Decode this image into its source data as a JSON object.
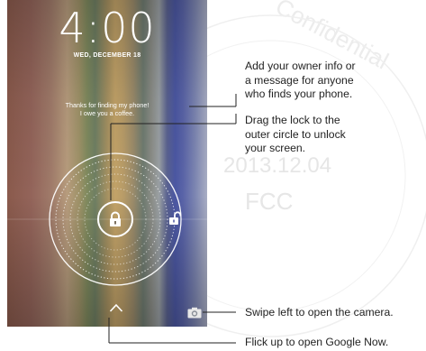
{
  "lockscreen": {
    "time": "4:00",
    "date": "WED, DECEMBER 18",
    "owner_message_line1": "Thanks for finding my phone!",
    "owner_message_line2": "I owe you a coffee."
  },
  "icons": {
    "lock": "lock-icon",
    "unlock": "unlock-icon",
    "camera": "camera-icon",
    "chevron_up": "chevron-up-icon"
  },
  "callouts": [
    {
      "lines": [
        "Add your owner info or",
        "a message for anyone",
        "who finds your phone."
      ]
    },
    {
      "lines": [
        "Drag the lock to the",
        "outer circle to unlock",
        "your screen."
      ]
    },
    {
      "lines": [
        "Swipe left to open the camera."
      ]
    },
    {
      "lines": [
        "Flick up to open Google Now."
      ]
    }
  ],
  "watermark": {
    "line1": "Confidential",
    "line2": "2013.12.04",
    "line3": "FCC"
  },
  "colors": {
    "leader_line": "#222222",
    "text": "#222222",
    "ring": "#ffffff"
  }
}
